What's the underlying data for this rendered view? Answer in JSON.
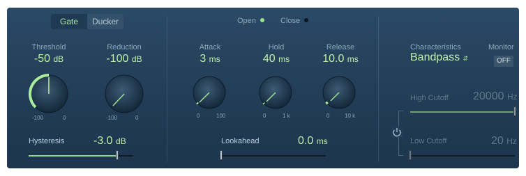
{
  "mode": {
    "gate": "Gate",
    "ducker": "Ducker"
  },
  "threshold": {
    "label": "Threshold",
    "value": "-50",
    "unit": "dB",
    "min": "-100",
    "max": "0"
  },
  "reduction": {
    "label": "Reduction",
    "value": "-100",
    "unit": "dB",
    "min": "-100",
    "max": "0"
  },
  "hysteresis": {
    "label": "Hysteresis",
    "value": "-3.0",
    "unit": "dB"
  },
  "sidechain": {
    "open": "Open",
    "close": "Close",
    "open_color": "#9be38f",
    "close_color": "#0b1622"
  },
  "attack": {
    "label": "Attack",
    "value": "3",
    "unit": "ms",
    "min": "0",
    "max": "100"
  },
  "hold": {
    "label": "Hold",
    "value": "40",
    "unit": "ms",
    "min": "0",
    "max": "1 k"
  },
  "release": {
    "label": "Release",
    "value": "10.0",
    "unit": "ms",
    "min": "0",
    "max": "10 k"
  },
  "lookahead": {
    "label": "Lookahead",
    "value": "0.0",
    "unit": "ms"
  },
  "characteristics": {
    "label": "Characteristics",
    "value": "Bandpass",
    "chevron": "⌃⌄"
  },
  "monitor": {
    "label": "Monitor",
    "value": "OFF"
  },
  "high_cutoff": {
    "label": "High Cutoff",
    "value": "20000",
    "unit": "Hz"
  },
  "low_cutoff": {
    "label": "Low Cutoff",
    "value": "20",
    "unit": "Hz"
  },
  "link_icon": "power-link-icon",
  "colors": {
    "accent": "#9be38f",
    "panel": "#243f59",
    "label": "#8fa5b9"
  }
}
